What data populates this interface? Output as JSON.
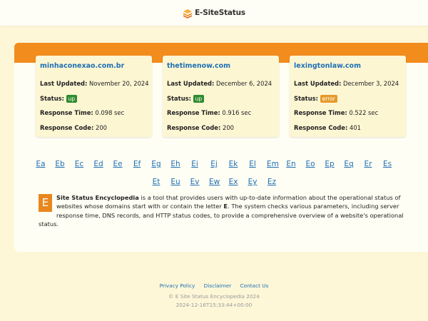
{
  "brand": {
    "name": "E-SiteStatus",
    "accent": "#f28c1d"
  },
  "cards": [
    {
      "domain": "minhaconexao.com.br",
      "last_updated_label": "Last Updated:",
      "last_updated": "November 20, 2024",
      "status_label": "Status:",
      "status": "up",
      "response_time_label": "Response Time:",
      "response_time": "0.098 sec",
      "response_code_label": "Response Code:",
      "response_code": "200"
    },
    {
      "domain": "thetimenow.com",
      "last_updated_label": "Last Updated:",
      "last_updated": "December 6, 2024",
      "status_label": "Status:",
      "status": "up",
      "response_time_label": "Response Time:",
      "response_time": "0.916 sec",
      "response_code_label": "Response Code:",
      "response_code": "200"
    },
    {
      "domain": "lexingtonlaw.com",
      "last_updated_label": "Last Updated:",
      "last_updated": "December 3, 2024",
      "status_label": "Status:",
      "status": "error",
      "response_time_label": "Response Time:",
      "response_time": "0.522 sec",
      "response_code_label": "Response Code:",
      "response_code": "401"
    }
  ],
  "letters": {
    "row1": [
      "Ea",
      "Eb",
      "Ec",
      "Ed",
      "Ee",
      "Ef",
      "Eg",
      "Eh",
      "Ei",
      "Ej",
      "Ek",
      "El",
      "Em",
      "En",
      "Eo",
      "Ep",
      "Eq",
      "Er",
      "Es"
    ],
    "row2": [
      "Et",
      "Eu",
      "Ev",
      "Ew",
      "Ex",
      "Ey",
      "Ez"
    ]
  },
  "description": {
    "badge": "E",
    "title": "Site Status Encyclopedia",
    "text_before": " is a tool that provides users with up-to-date information about the operational status of websites whose domains start with or contain the letter ",
    "letter": "E",
    "text_after": ". The system checks various parameters, including server response time, DNS records, and HTTP status codes, to provide a comprehensive overview of a website's operational status."
  },
  "footer": {
    "links": [
      "Privacy Policy",
      "Disclaimer",
      "Contact Us"
    ],
    "copyright": "© E Site Status Encyclopedia 2024",
    "timestamp": "2024-12-16T15:33:44+00:00"
  }
}
